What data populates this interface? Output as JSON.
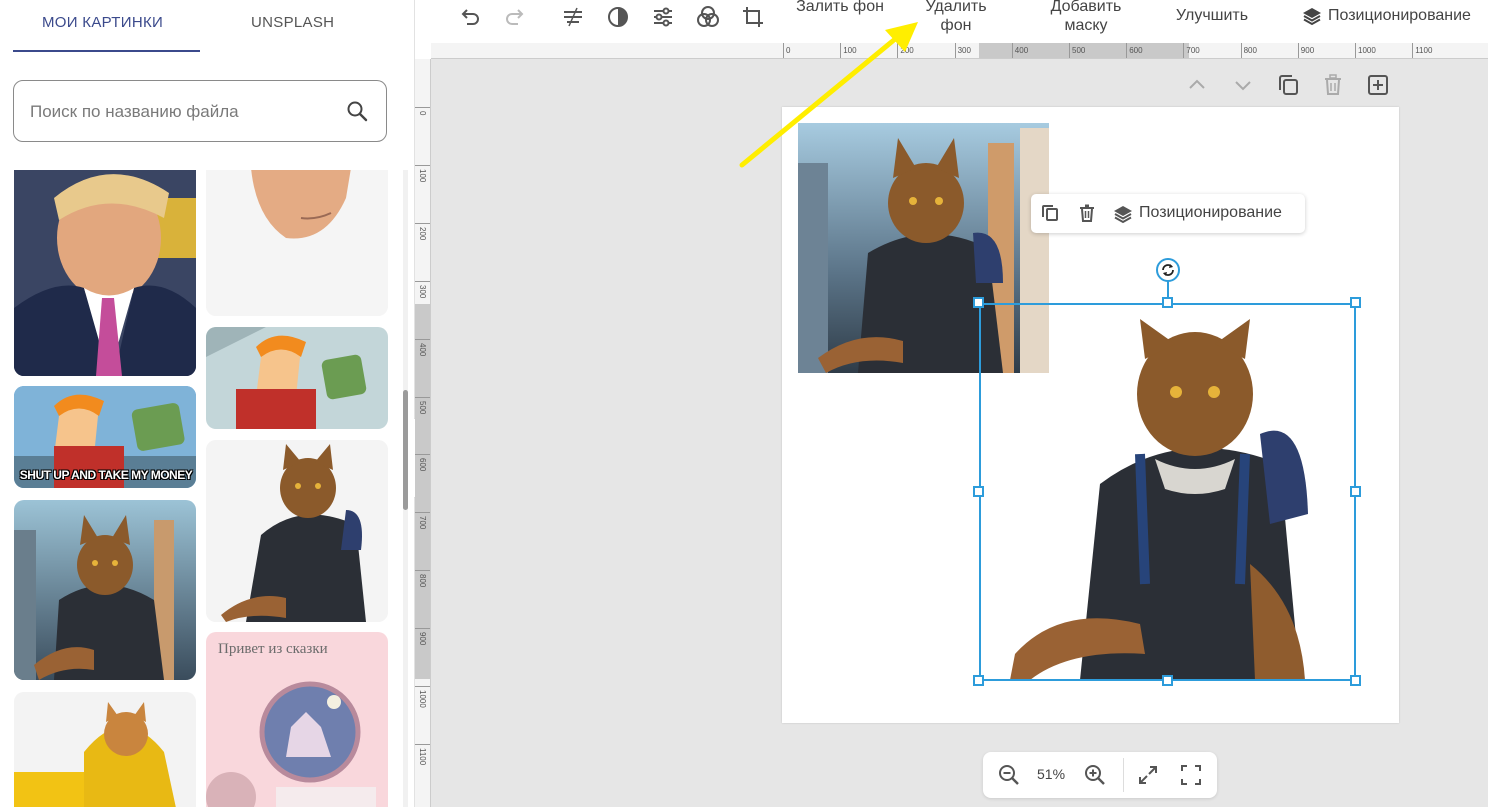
{
  "sidebar": {
    "tabs": [
      {
        "label": "МОИ КАРТИНКИ",
        "active": true
      },
      {
        "label": "UNSPLASH",
        "active": false
      }
    ],
    "search": {
      "placeholder": "Поиск по названию файла",
      "icon": "search-icon"
    },
    "meme_caption": "SHUT UP AND TAKE MY MONEY",
    "card_title": "Привет из сказки"
  },
  "toolbar": {
    "icons": [
      "undo-icon",
      "redo-icon",
      "align-icon",
      "contrast-icon",
      "adjustments-icon",
      "blend-icon",
      "crop-icon"
    ],
    "fill_bg": "Залить фон",
    "remove_bg": "Удалить фон",
    "add_mask": "Добавить маску",
    "improve": "Улучшить",
    "positioning": "Позиционирование"
  },
  "ruler": {
    "top": [
      "0",
      "100",
      "200",
      "300",
      "400",
      "500",
      "600",
      "700",
      "800",
      "900",
      "1000",
      "1100"
    ],
    "left": [
      "0",
      "100",
      "200",
      "300",
      "400",
      "500",
      "600",
      "700",
      "800",
      "900",
      "1000",
      "1100"
    ]
  },
  "canvas_controls": {
    "icons": [
      "chevron-up-icon",
      "chevron-down-icon",
      "duplicate-icon",
      "trash-icon",
      "add-page-icon"
    ]
  },
  "floating_toolbar": {
    "positioning": "Позиционирование"
  },
  "zoom": {
    "value": "51%"
  },
  "colors": {
    "accent": "#3b4a8c",
    "selection": "#2d9cdb",
    "arrow": "#ffee00"
  }
}
